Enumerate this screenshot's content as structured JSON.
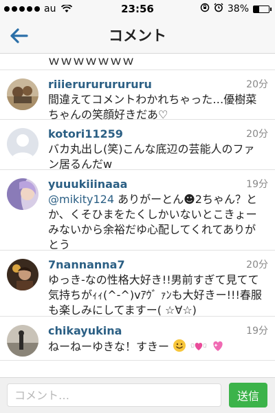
{
  "status": {
    "carrier": "au",
    "time": "23:56",
    "battery_text": "38%",
    "battery_level": 0.38,
    "signal_dots": 5
  },
  "header": {
    "title": "コメント"
  },
  "partial_comment": {
    "text": "ｗｗｗｗｗｗｗ"
  },
  "comments": [
    {
      "username": "riiierurururururu",
      "time": "20分",
      "text": "間違えてコメントわかれちゃった…優樹菜ちゃんの笑顔好きだあ♡"
    },
    {
      "username": "kotori11259",
      "time": "20分",
      "text": "バカ丸出し(笑)こんな底辺の芸能人のファン居るんだw"
    },
    {
      "username": "yuuukiiinaaa",
      "time": "19分",
      "mention": "@mikity124",
      "text": " ありがーとん☻2ちゃん？とか、くそひまをたくしかいないとこきょーみないから余裕だゆ心配してくれてありがとう"
    },
    {
      "username": "7nannanna7",
      "time": "20分",
      "text": "ゆっき-なの性格大好き!!男前すぎて見てて気持ちがｨｨ(^-^)vｱｳﾞ ｧﾝも大好きー!!!春服も楽しみにしてますー( ☆∀☆)"
    },
    {
      "username": "chikayukina",
      "time": "19分",
      "text": "ねーねーゆきな！すきー"
    }
  ],
  "input": {
    "placeholder": "コメント…",
    "value": "",
    "send_label": "送信"
  },
  "colors": {
    "username": "#2b5f84",
    "send_button": "#3cb34a",
    "back_arrow": "#2b6fa8"
  }
}
